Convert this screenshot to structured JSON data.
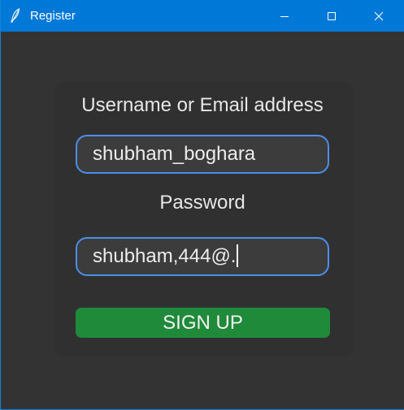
{
  "window": {
    "title": "Register",
    "accent_color": "#0078d7",
    "icon": "feather-icon"
  },
  "form": {
    "username_label": "Username or Email address",
    "username_value": "shubham_boghara",
    "password_label": "Password",
    "password_value": "shubham,444@.",
    "signup_label": "SIGN UP",
    "field_border_color": "#4b8fe8",
    "signup_color": "#1f8a3a"
  }
}
